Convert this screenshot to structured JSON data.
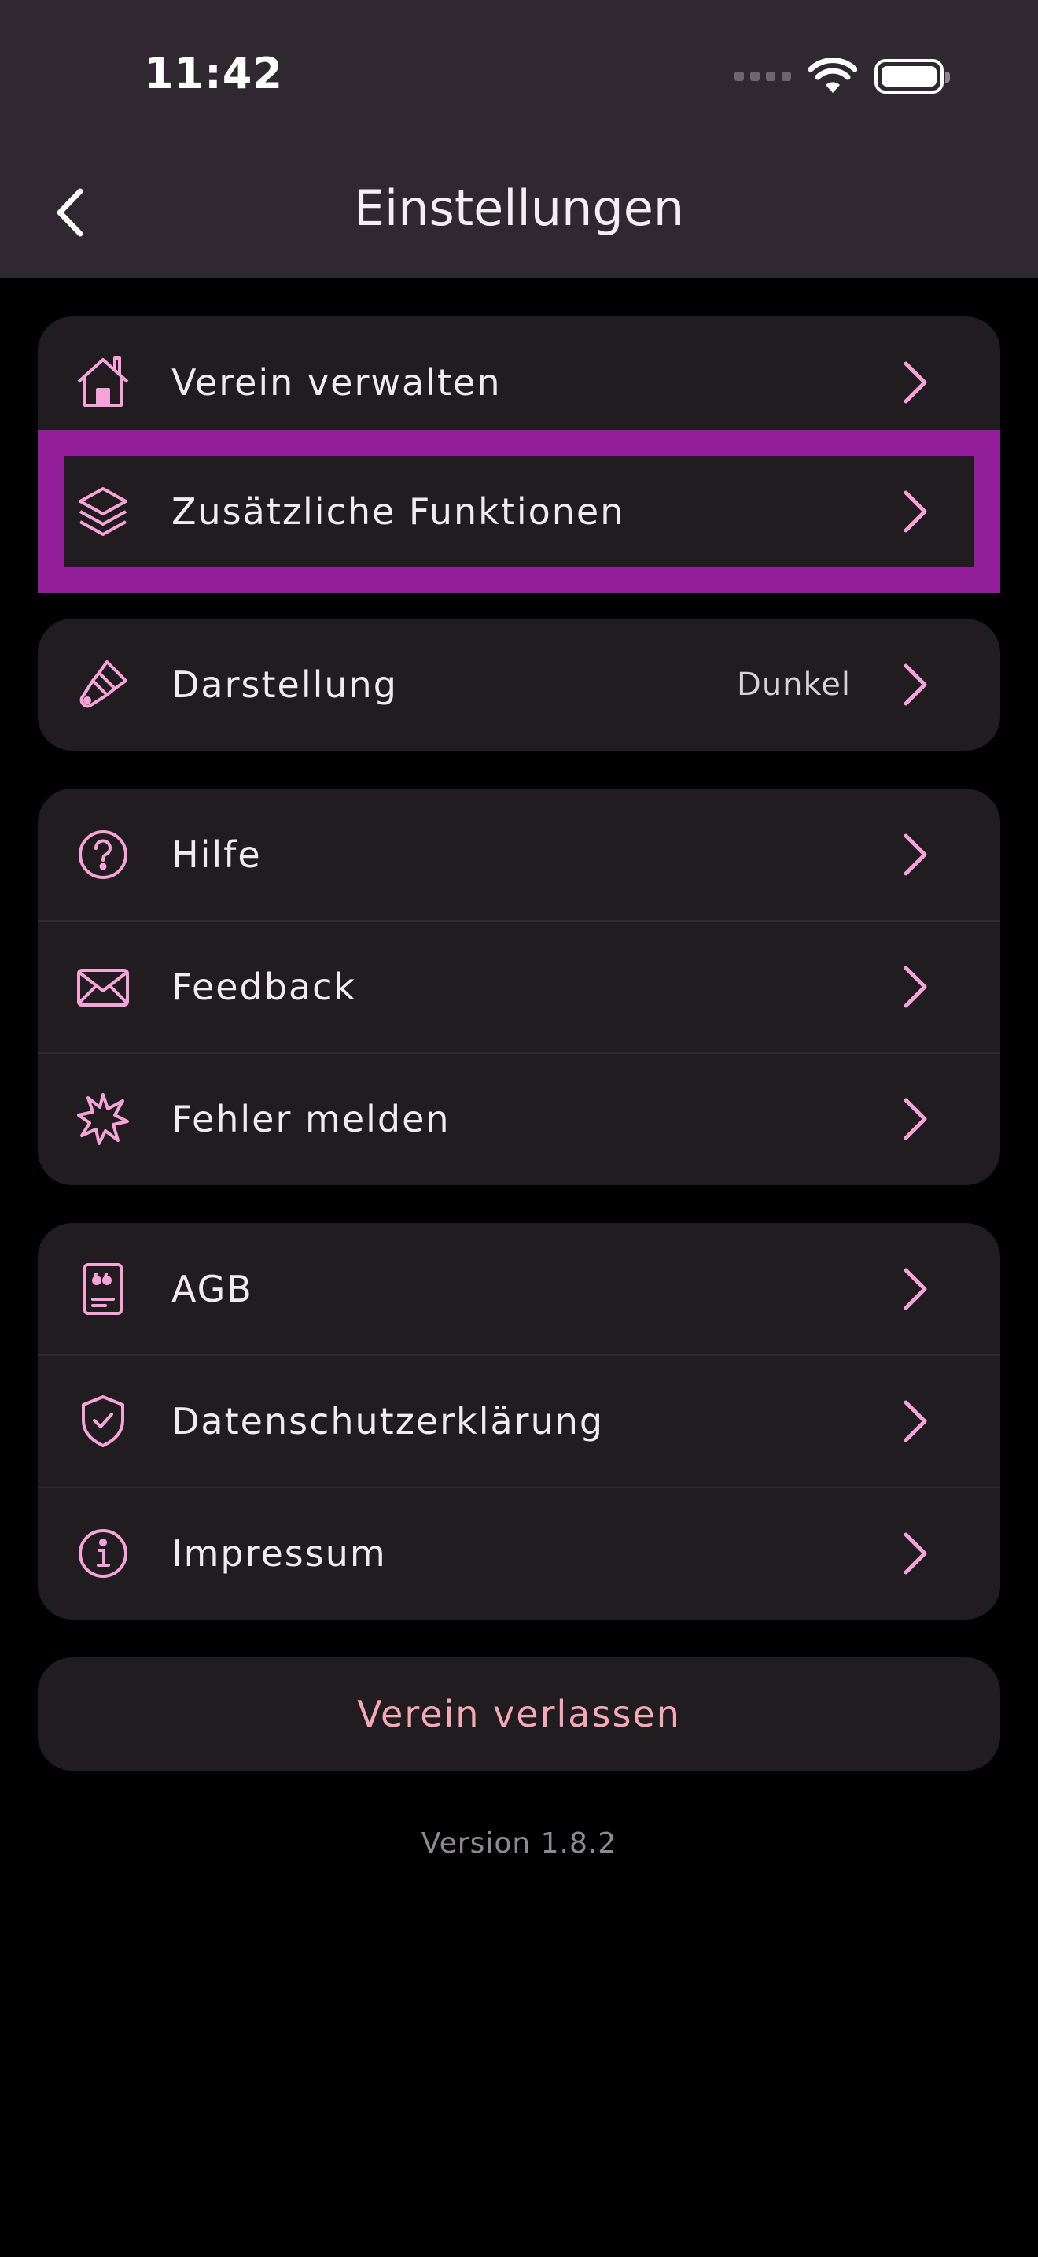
{
  "status_bar": {
    "time": "11:42"
  },
  "header": {
    "title": "Einstellungen"
  },
  "colors": {
    "accent": "#f5a3d8",
    "highlight": "#93209a",
    "leave_text": "#f5a9b4"
  },
  "groups": [
    {
      "items": [
        {
          "label": "Verein verwalten",
          "icon": "house-icon"
        },
        {
          "label": "Zusätzliche Funktionen",
          "icon": "layers-icon"
        }
      ]
    },
    {
      "items": [
        {
          "label": "Darstellung",
          "value": "Dunkel",
          "icon": "paintbrush-icon"
        }
      ]
    },
    {
      "items": [
        {
          "label": "Hilfe",
          "icon": "question-circle-icon"
        },
        {
          "label": "Feedback",
          "icon": "envelope-icon"
        },
        {
          "label": "Fehler melden",
          "icon": "burst-icon"
        }
      ]
    },
    {
      "items": [
        {
          "label": "AGB",
          "icon": "document-quote-icon"
        },
        {
          "label": "Datenschutzerklärung",
          "icon": "shield-check-icon"
        },
        {
          "label": "Impressum",
          "icon": "info-circle-icon"
        }
      ]
    }
  ],
  "leave_button": {
    "label": "Verein verlassen"
  },
  "footer": {
    "version": "Version 1.8.2"
  }
}
